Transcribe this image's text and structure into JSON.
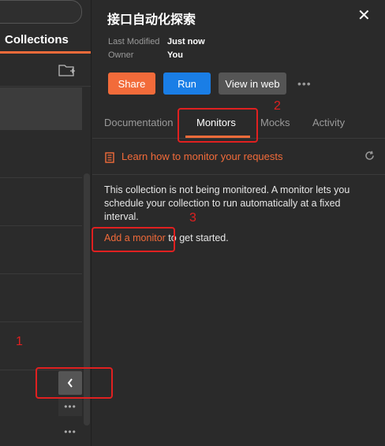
{
  "sidebar": {
    "tab_label": "Collections",
    "dots_label": "•••"
  },
  "panel": {
    "title": "接口自动化探索",
    "close_glyph": "✕",
    "meta": {
      "last_modified_label": "Last Modified",
      "last_modified_value": "Just now",
      "owner_label": "Owner",
      "owner_value": "You"
    },
    "buttons": {
      "share": "Share",
      "run": "Run",
      "view_web": "View in web",
      "more": "•••"
    },
    "tabs": [
      {
        "label": "Documentation",
        "active": false
      },
      {
        "label": "Monitors",
        "active": true
      },
      {
        "label": "Mocks",
        "active": false
      },
      {
        "label": "Activity",
        "active": false
      }
    ],
    "learn_link": "Learn how to monitor your requests",
    "message": "This collection is not being monitored. A monitor lets you schedule your collection to run automatically at a fixed interval.",
    "cta_link": "Add a monitor",
    "cta_suffix": " to get started."
  },
  "annotations": {
    "labels": [
      "1",
      "2",
      "3"
    ],
    "color": "#e02020"
  },
  "colors": {
    "accent": "#f26b3a",
    "run_blue": "#1a7ee6",
    "background": "#2a2a2a"
  },
  "icons": [
    "new-folder-icon",
    "chevron-left-icon",
    "book-icon",
    "refresh-icon",
    "close-icon"
  ]
}
